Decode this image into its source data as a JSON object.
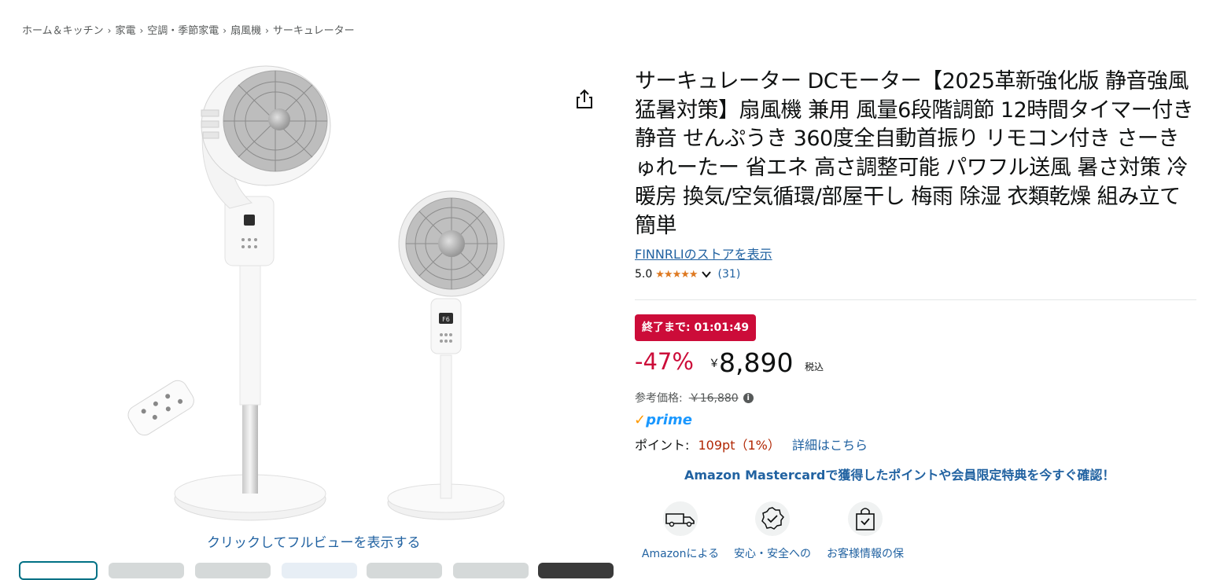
{
  "breadcrumb": [
    "ホーム＆キッチン",
    "家電",
    "空調・季節家電",
    "扇風機",
    "サーキュレーター"
  ],
  "gallery": {
    "full_view_link": "クリックしてフルビューを表示する",
    "thumbnail_count": 7,
    "fan_display_text": "F6"
  },
  "product": {
    "title": "サーキュレーター DCモーター【2025革新強化版 静音強風 猛暑対策】扇風機 兼用 風量6段階調節 12時間タイマー付き 静音 せんぷうき 360度全自動首振り リモコン付き さーきゅれーたー 省エネ 高さ調整可能 パワフル送風 暑さ対策 冷暖房 換気/空気循環/部屋干し 梅雨 除湿 衣類乾燥 組み立て簡単",
    "store_link": "FINNRLIのストアを表示",
    "rating": "5.0",
    "stars": "★★★★★",
    "review_count": "(31)"
  },
  "deal": {
    "badge": "終了まで: 01:01:49"
  },
  "pricing": {
    "discount": "-47%",
    "currency_symbol": "￥",
    "price": "8,890",
    "tax_label": "税込",
    "list_price_label": "参考価格:",
    "list_price": "￥16,880"
  },
  "prime": {
    "check": "✓",
    "label": "prime"
  },
  "points": {
    "label": "ポイント:",
    "value": "109pt（1%）",
    "detail_link": "詳細はこちら"
  },
  "promo": "Amazon Mastercardで獲得したポイントや会員限定特典を今すぐ確認！",
  "features": [
    {
      "icon": "delivery-truck-icon",
      "label": "Amazonによる"
    },
    {
      "icon": "safety-badge-icon",
      "label": "安心・安全への"
    },
    {
      "icon": "secure-bag-icon",
      "label": "お客様情報の保"
    }
  ],
  "colors": {
    "link": "#2162a1",
    "deal_red": "#cc0c39",
    "star": "#de7921",
    "points": "#b12704",
    "prime_blue": "#1a98ff"
  }
}
